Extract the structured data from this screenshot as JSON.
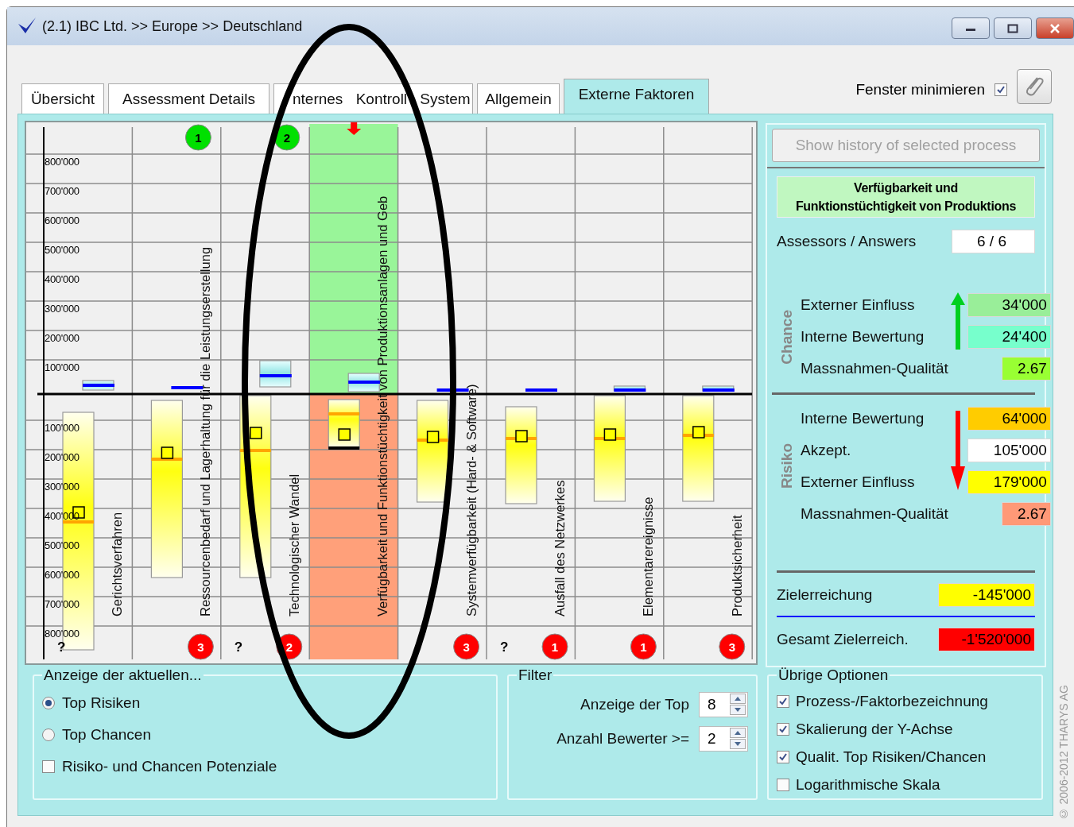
{
  "window": {
    "title": "(2.1) IBC Ltd. >> Europe >> Deutschland"
  },
  "tabs": [
    {
      "label": "Übersicht",
      "selected": false
    },
    {
      "label": "Assessment Details",
      "selected": false
    },
    {
      "label": "nternes Kontroll System",
      "selected": false
    },
    {
      "label": "Allgemein",
      "selected": false
    },
    {
      "label": "Externe Faktoren",
      "selected": true
    }
  ],
  "minimize_window": {
    "label": "Fenster minimieren",
    "checked": true
  },
  "chart": {
    "upper_axis_labels": [
      "800'000",
      "700'000",
      "600'000",
      "500'000",
      "400'000",
      "300'000",
      "200'000",
      "100'000"
    ],
    "lower_axis_labels": [
      "100'000",
      "200'000",
      "300'000",
      "400'000",
      "500'000",
      "600'000",
      "700'000",
      "800'000"
    ],
    "columns": [
      {
        "label": "Gerichtsverfahren",
        "selected": false,
        "bottom_mark": "?"
      },
      {
        "label": "Ressourcenbedarf und Lagerhaltung für die Leistungserstellung",
        "selected": false,
        "top_badge": "1",
        "bottom_badge": "3"
      },
      {
        "label": "Technologischer Wandel",
        "selected": false,
        "top_badge": "2",
        "bottom_mark": "?",
        "bottom_badge": "2"
      },
      {
        "label": "Verfügbarkeit und Funktionstüchtigkeit von Produktionsanlagen und Geb",
        "selected": true
      },
      {
        "label": "Systemverfügbarkeit (Hard- & Software)",
        "selected": false,
        "bottom_badge": "3"
      },
      {
        "label": "Ausfall des Netzwerkes",
        "selected": false,
        "bottom_mark": "?",
        "bottom_badge": "1"
      },
      {
        "label": "Elementarereignisse",
        "selected": false,
        "bottom_badge": "1"
      },
      {
        "label": "Produktsicherheit",
        "selected": false,
        "bottom_badge": "3"
      }
    ]
  },
  "details": {
    "history_button": {
      "label": "Show history of selected process",
      "disabled": true
    },
    "title_lines": [
      "Verfügbarkeit und",
      "Funktionstüchtigkeit von Produktions"
    ],
    "assessors": {
      "label": "Assessors / Answers",
      "value": "6 / 6"
    },
    "groups": [
      {
        "kind": "chance",
        "heading": "Chance",
        "rows": [
          {
            "label": "Externer Einfluss",
            "value": "34'000",
            "color": "#99ee99"
          },
          {
            "label": "Interne Bewertung",
            "value": "24'400",
            "color": "#77ffcc"
          },
          {
            "label": "Massnahmen-Qualität",
            "value": "2.67",
            "color": "#99ff33"
          }
        ]
      },
      {
        "kind": "risk",
        "heading": "Risiko",
        "rows": [
          {
            "label": "Interne Bewertung",
            "value": "64'000",
            "color": "#ffcc00"
          },
          {
            "label": "Akzept.",
            "value": "105'000",
            "color": "#ffffff"
          },
          {
            "label": "Externer Einfluss",
            "value": "179'000",
            "color": "#ffff00"
          },
          {
            "label": "Massnahmen-Qualität",
            "value": "2.67",
            "color": "#ff9977"
          }
        ]
      }
    ],
    "totals": [
      {
        "label": "Zielerreichung",
        "value": "-145'000",
        "color": "#ffff00"
      },
      {
        "label": "Gesamt Zielerreich.",
        "value": "-1'520'000",
        "color": "#ff0000"
      }
    ]
  },
  "display_group": {
    "legend": "Anzeige der aktuellen...",
    "options": [
      {
        "kind": "radio",
        "label": "Top Risiken",
        "selected": true
      },
      {
        "kind": "radio",
        "label": "Top Chancen",
        "selected": false
      },
      {
        "kind": "checkbox",
        "label": "Risiko- und Chancen Potenziale",
        "checked": false
      }
    ]
  },
  "filter": {
    "legend": "Filter",
    "fields": [
      {
        "label": "Anzeige der Top",
        "value": "8"
      },
      {
        "label": "Anzahl Bewerter >=",
        "value": "2"
      }
    ]
  },
  "other_options": {
    "legend": "Übrige Optionen",
    "options": [
      {
        "label": "Prozess-/Faktorbezeichnung",
        "checked": true
      },
      {
        "label": "Skalierung der Y-Achse",
        "checked": true
      },
      {
        "label": "Qualit. Top Risiken/Chancen",
        "checked": true
      },
      {
        "label": "Logarithmische Skala",
        "checked": false
      }
    ]
  },
  "copyright": "© 2006-2012 THARYS AG",
  "annotation": {
    "kind": "ellipse"
  }
}
